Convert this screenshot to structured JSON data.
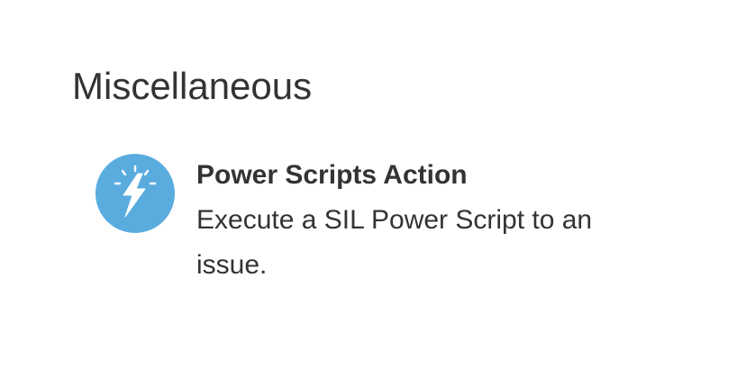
{
  "section": {
    "title": "Miscellaneous"
  },
  "action": {
    "icon": "lightning-bolt-icon",
    "icon_color": "#5aacdf",
    "title": "Power Scripts Action",
    "description": "Execute a SIL Power Script to an issue."
  }
}
